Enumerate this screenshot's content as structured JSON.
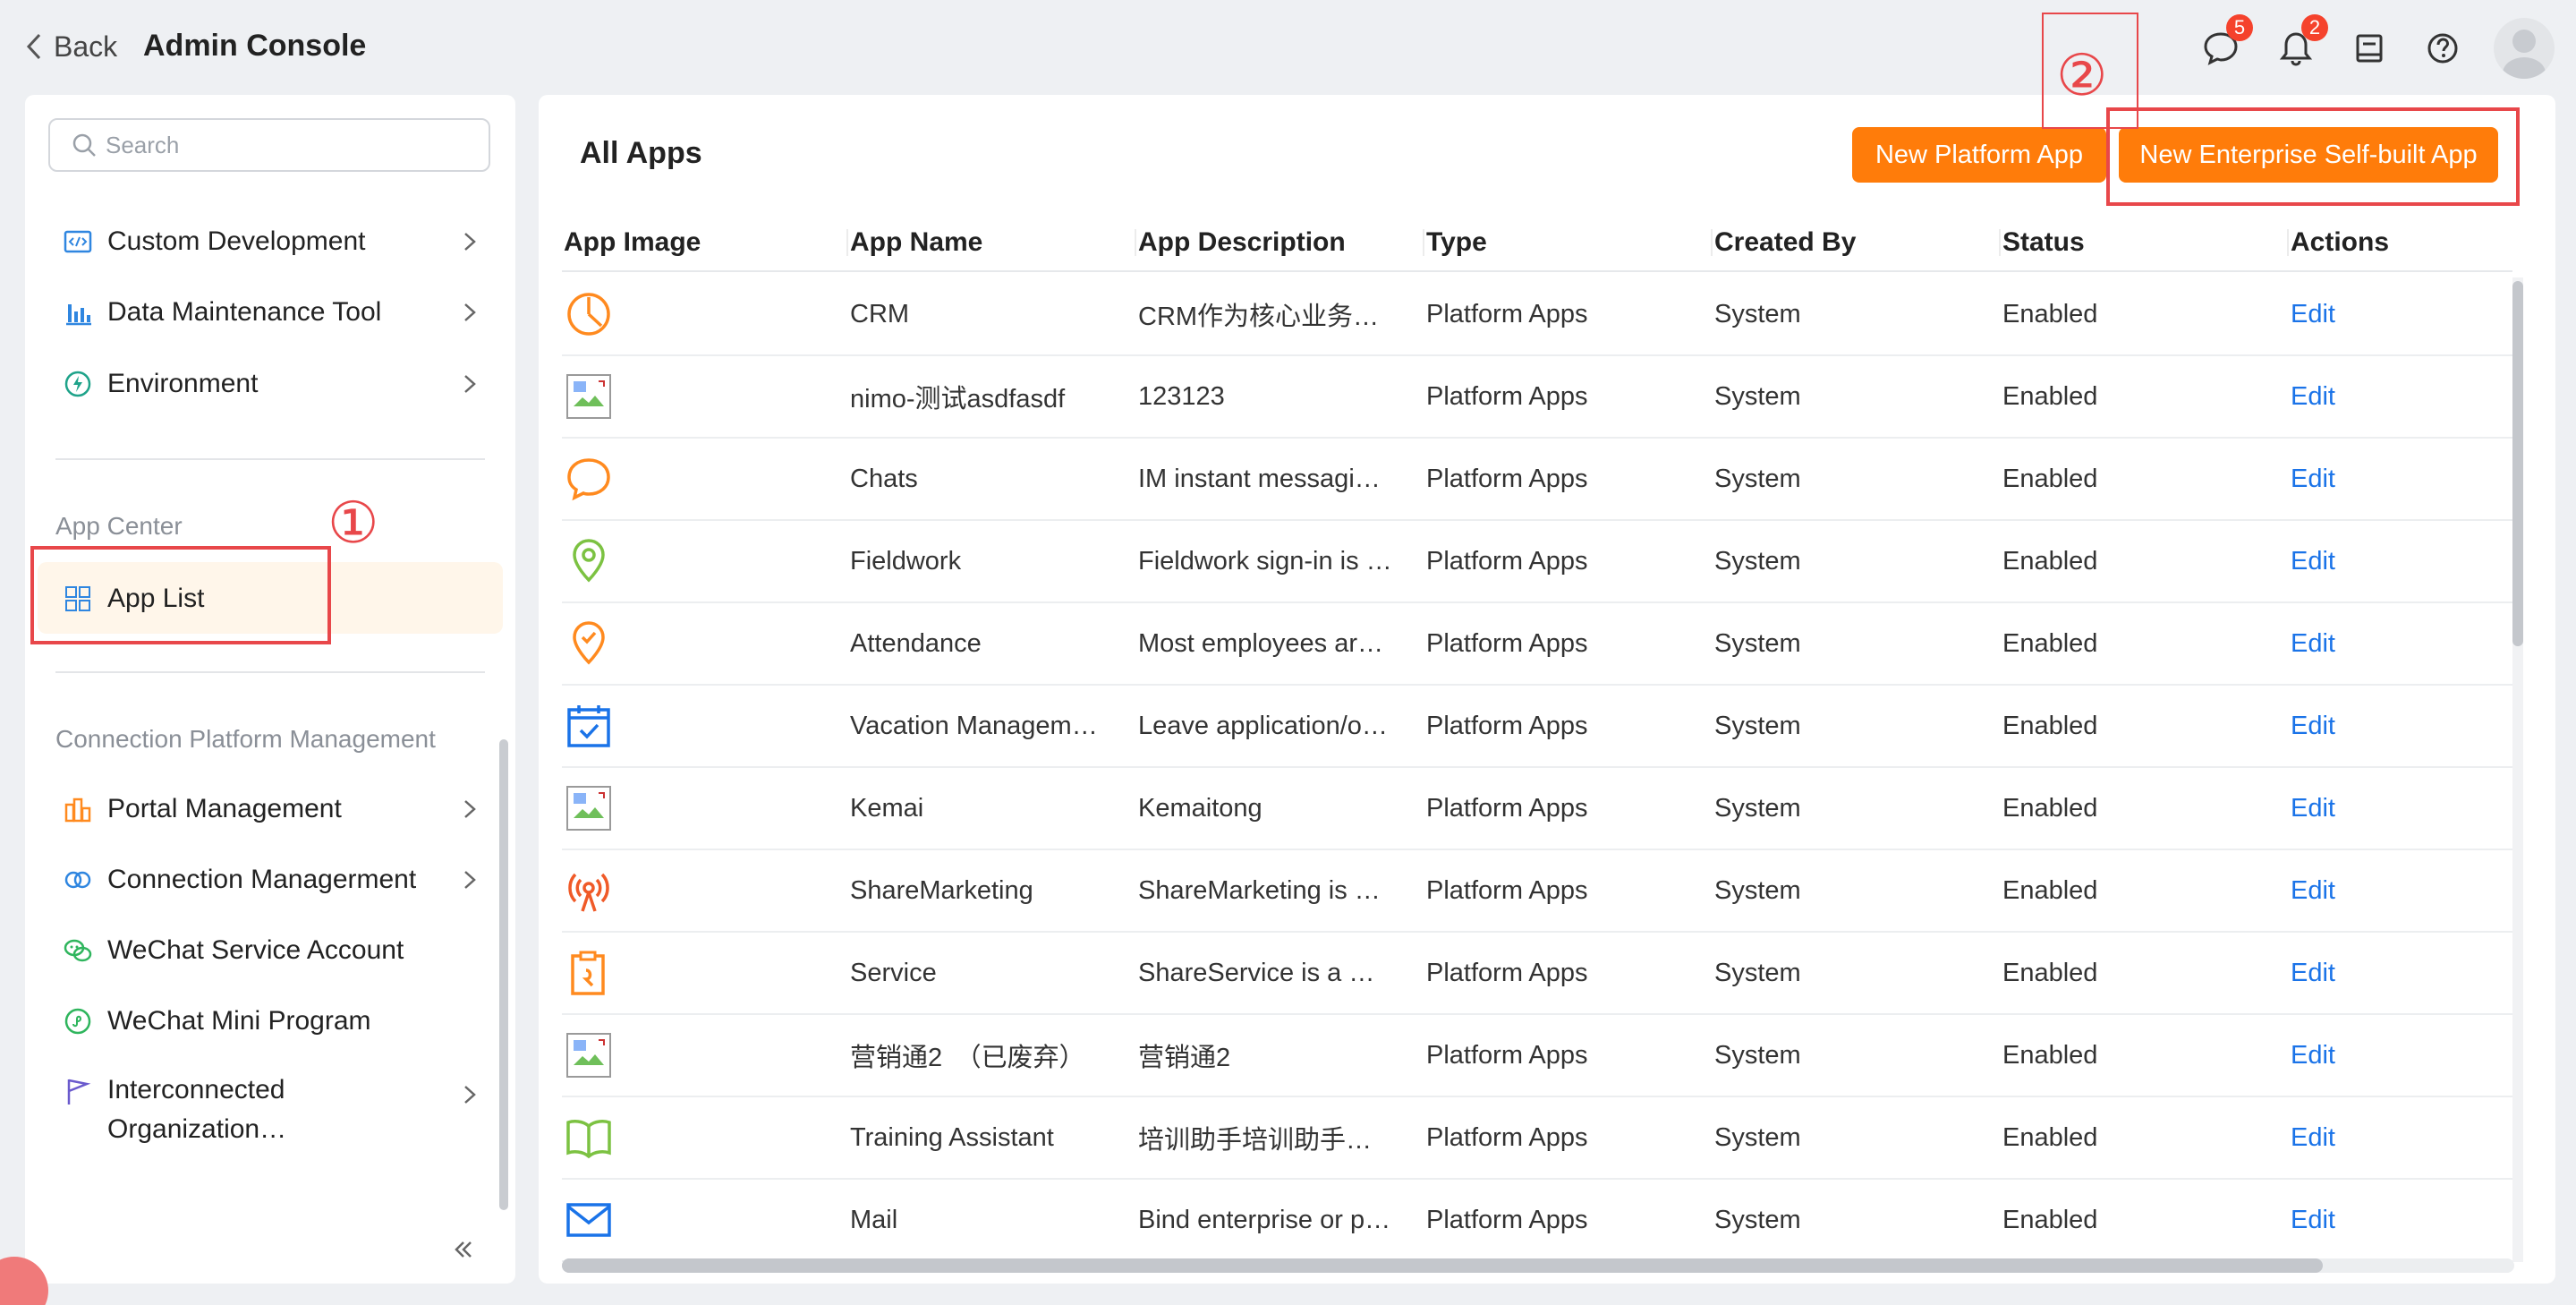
{
  "header": {
    "back_label": "Back",
    "title": "Admin Console",
    "messages_badge": "5",
    "notifications_badge": "2"
  },
  "sidebar": {
    "search_placeholder": "Search",
    "dev_items": [
      {
        "label": "Custom Development",
        "icon": "code-icon"
      },
      {
        "label": "Data Maintenance Tool",
        "icon": "bar-chart-icon"
      },
      {
        "label": "Environment",
        "icon": "environment-icon"
      }
    ],
    "app_center_label": "App Center",
    "app_list_label": "App List",
    "connection_label": "Connection Platform Management",
    "connection_items": [
      {
        "label": "Portal Management",
        "icon": "portal-icon"
      },
      {
        "label": "Connection Managerment",
        "icon": "link-icon"
      },
      {
        "label": "WeChat Service Account",
        "icon": "wechat-icon"
      },
      {
        "label": "WeChat Mini Program",
        "icon": "mini-program-icon"
      }
    ],
    "interconnected_line1": "Interconnected",
    "interconnected_line2": "Organization…"
  },
  "main": {
    "title": "All Apps",
    "new_platform_app": "New Platform App",
    "new_enterprise_app": "New Enterprise Self-built App",
    "columns": [
      "App Image",
      "App Name",
      "App Description",
      "Type",
      "Created By",
      "Status",
      "Actions"
    ],
    "rows": [
      {
        "icon": "crm-pie-icon",
        "name": "CRM",
        "desc": "CRM作为核心业务…",
        "type": "Platform Apps",
        "created_by": "System",
        "status": "Enabled",
        "action": "Edit"
      },
      {
        "icon": "broken-image-icon",
        "name": "nimo-测试asdfasdf",
        "desc": "123123",
        "type": "Platform Apps",
        "created_by": "System",
        "status": "Enabled",
        "action": "Edit"
      },
      {
        "icon": "chat-bubble-icon",
        "name": "Chats",
        "desc": "IM instant messagi…",
        "type": "Platform Apps",
        "created_by": "System",
        "status": "Enabled",
        "action": "Edit"
      },
      {
        "icon": "location-pin-icon",
        "name": "Fieldwork",
        "desc": "Fieldwork sign-in is …",
        "type": "Platform Apps",
        "created_by": "System",
        "status": "Enabled",
        "action": "Edit"
      },
      {
        "icon": "attendance-pin-icon",
        "name": "Attendance",
        "desc": "Most employees ar…",
        "type": "Platform Apps",
        "created_by": "System",
        "status": "Enabled",
        "action": "Edit"
      },
      {
        "icon": "calendar-check-icon",
        "name": "Vacation Managem…",
        "desc": "Leave application/o…",
        "type": "Platform Apps",
        "created_by": "System",
        "status": "Enabled",
        "action": "Edit"
      },
      {
        "icon": "broken-image-icon",
        "name": "Kemai",
        "desc": "Kemaitong",
        "type": "Platform Apps",
        "created_by": "System",
        "status": "Enabled",
        "action": "Edit"
      },
      {
        "icon": "broadcast-icon",
        "name": "ShareMarketing",
        "desc": "ShareMarketing is …",
        "type": "Platform Apps",
        "created_by": "System",
        "status": "Enabled",
        "action": "Edit"
      },
      {
        "icon": "service-clipboard-icon",
        "name": "Service",
        "desc": "ShareService is a …",
        "type": "Platform Apps",
        "created_by": "System",
        "status": "Enabled",
        "action": "Edit"
      },
      {
        "icon": "broken-image-icon",
        "name": "营销通2　（已废弃）",
        "desc": "营销通2",
        "type": "Platform Apps",
        "created_by": "System",
        "status": "Enabled",
        "action": "Edit"
      },
      {
        "icon": "book-icon",
        "name": "Training Assistant",
        "desc": "培训助手培训助手…",
        "type": "Platform Apps",
        "created_by": "System",
        "status": "Enabled",
        "action": "Edit"
      },
      {
        "icon": "mail-icon",
        "name": "Mail",
        "desc": "Bind enterprise or p…",
        "type": "Platform Apps",
        "created_by": "System",
        "status": "Enabled",
        "action": "Edit"
      }
    ]
  },
  "annotations": {
    "step1": "①",
    "step2": "②"
  },
  "colors": {
    "accent": "#ff7c0a",
    "link": "#1a73e8",
    "annotation": "#e8474a",
    "active_bg": "#fff6ea"
  }
}
